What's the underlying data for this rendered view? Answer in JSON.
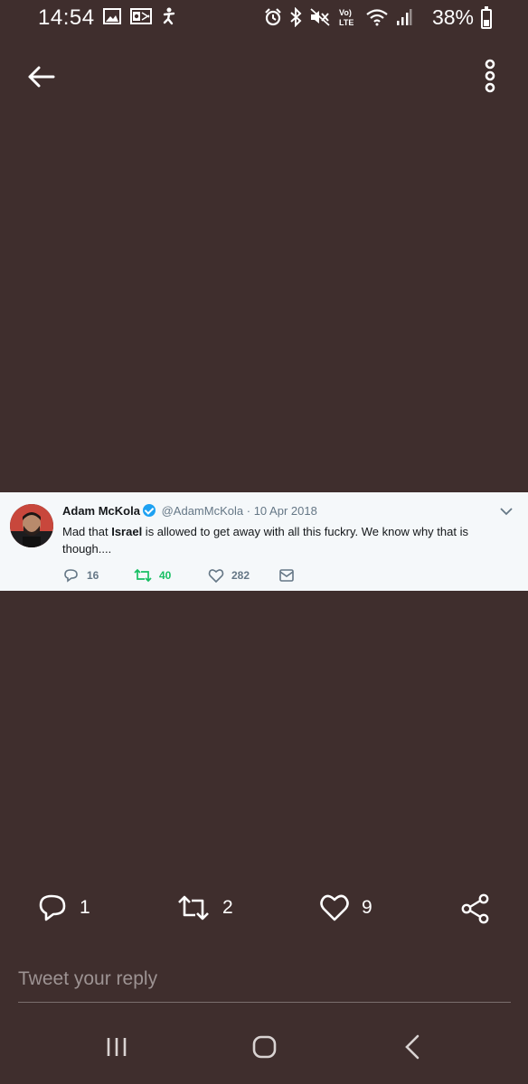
{
  "status_bar": {
    "time": "14:54",
    "battery_percent": "38%",
    "battery_level": 0.38,
    "left_icons": [
      "image-icon",
      "outlook-icon",
      "accessibility-icon"
    ],
    "right_icons": [
      "alarm-icon",
      "bluetooth-icon",
      "mute-icon",
      "volte-icon",
      "wifi-icon",
      "signal-icon",
      "battery-icon"
    ],
    "volte_top": "Vo)",
    "volte_bottom": "LTE"
  },
  "top_bar": {
    "back_icon": "arrow-left-icon",
    "more_icon": "more-vertical-icon"
  },
  "tweet": {
    "author_name": "Adam McKola",
    "handle": "@AdamMcKola",
    "separator": "·",
    "date": "10 Apr 2018",
    "text_before": "Mad that ",
    "text_bold": "Israel",
    "text_after": " is allowed to get away with all this fuckry. We know why that is though....",
    "replies": "16",
    "retweets": "40",
    "likes": "282",
    "colors": {
      "retweet": "#17bf63",
      "verified": "#1da1f2",
      "muted": "#657786"
    }
  },
  "stats": {
    "replies": "1",
    "retweets": "2",
    "likes": "9"
  },
  "reply": {
    "placeholder": "Tweet your reply"
  },
  "nav": {
    "icons": [
      "recent-apps-icon",
      "home-icon",
      "back-icon"
    ]
  },
  "colors": {
    "background": "#3f2e2d",
    "card": "#f5f8fa"
  }
}
